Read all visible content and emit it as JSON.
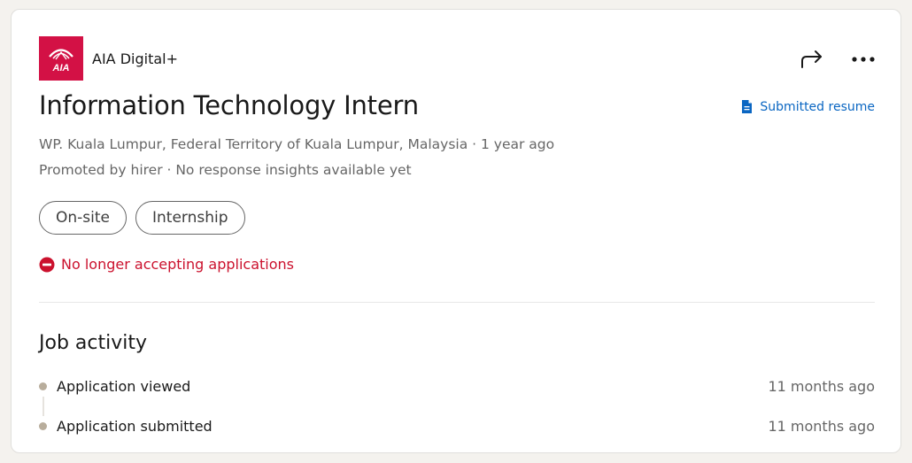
{
  "company": {
    "name": "AIA Digital+",
    "logo_text": "AIA",
    "logo_color": "#d31145"
  },
  "actions": {
    "share_icon": "share-arrow-icon",
    "more_icon": "more-horizontal-icon"
  },
  "job": {
    "title": "Information Technology Intern",
    "location_line": "WP. Kuala Lumpur, Federal Territory of Kuala Lumpur, Malaysia · 1 year ago",
    "promoted_line": "Promoted by hirer · No response insights available yet",
    "resume_link": "Submitted resume",
    "pills": [
      "On-site",
      "Internship"
    ],
    "status": "No longer accepting applications",
    "status_color": "#cb112d"
  },
  "activity": {
    "title": "Job activity",
    "items": [
      {
        "label": "Application viewed",
        "time": "11 months ago"
      },
      {
        "label": "Application submitted",
        "time": "11 months ago"
      }
    ]
  }
}
